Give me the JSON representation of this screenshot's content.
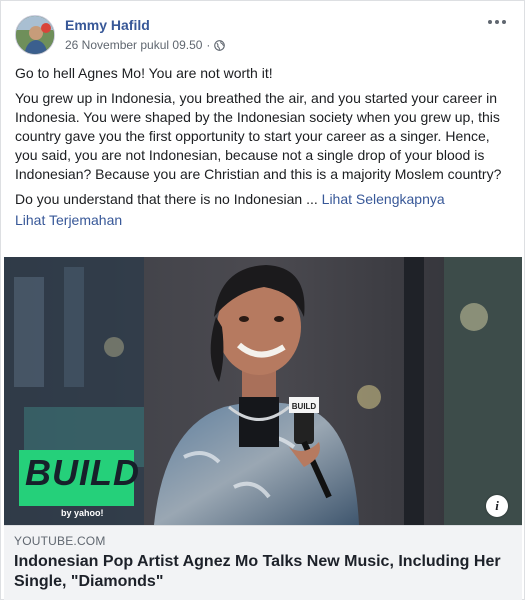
{
  "post": {
    "author": "Emmy Hafild",
    "timestamp": "26 November pukul 09.50",
    "separator": "·",
    "privacy_icon": "globe-icon",
    "more_icon": "ellipsis-icon",
    "paragraphs": [
      "Go to hell Agnes Mo! You are not worth it!",
      "You grew up in Indonesia, you breathed the air, and you started your career in Indonesia. You were shaped by the Indonesian society when you grew up, this country gave you the first opportunity to start your career as a singer. Hence, you said, you are not Indonesian, because not a single drop of your blood is Indonesian? Because you are Christian and this is a majority Moslem country?"
    ],
    "truncated_text": "Do you understand that there is no Indonesian ...",
    "see_more": "Lihat Selengkapnya",
    "see_translation": "Lihat Terjemahan"
  },
  "link_preview": {
    "logo_text": "BUILD",
    "logo_sub": "by yahoo!",
    "info_icon_glyph": "i",
    "domain": "YOUTUBE.COM",
    "title": "Indonesian Pop Artist Agnez Mo Talks New Music, Including Her Single, \"Diamonds\""
  },
  "colors": {
    "link_blue": "#385898",
    "build_green": "#25d07a",
    "footer_bg": "#f2f3f5"
  }
}
